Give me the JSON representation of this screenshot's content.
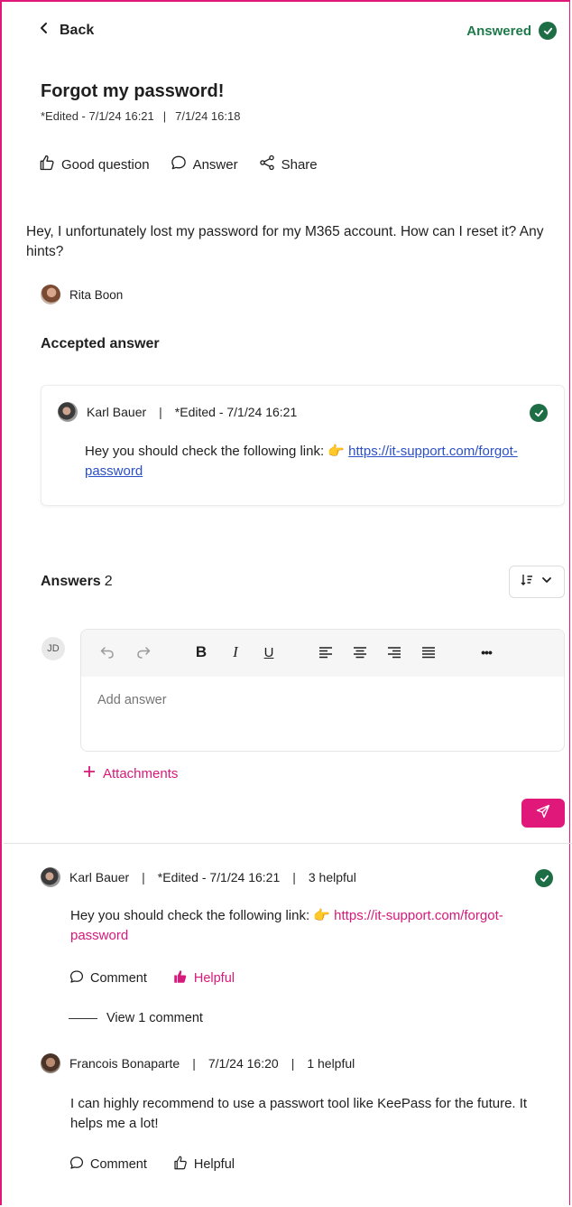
{
  "nav": {
    "back_label": "Back"
  },
  "status": {
    "label": "Answered",
    "color": "#1e6e45",
    "icon": "check-circle-icon"
  },
  "question": {
    "title": "Forgot my password!",
    "edited": "*Edited - 7/1/24 16:21",
    "created": "7/1/24 16:18",
    "body": "Hey, I unfortunately lost my password for my M365 account. How can I reset it? Any hints?",
    "author": "Rita Boon"
  },
  "actions": {
    "good_question": "Good question",
    "answer": "Answer",
    "share": "Share"
  },
  "accepted": {
    "heading": "Accepted answer",
    "author": "Karl Bauer",
    "edited": "*Edited - 7/1/24 16:21",
    "text": "Hey you should check the following link: ",
    "emoji": "👉",
    "link": "https://it-support.com/forgot-password"
  },
  "answers_section": {
    "heading": "Answers",
    "count": "2"
  },
  "editor": {
    "user_initials": "JD",
    "placeholder": "Add answer",
    "toolbar": {
      "undo": "undo-icon",
      "redo": "redo-icon",
      "bold": "B",
      "italic": "I",
      "underline": "U",
      "more": "•••"
    },
    "attachments_label": "Attachments"
  },
  "answers": [
    {
      "author": "Karl Bauer",
      "edited": "*Edited - 7/1/24 16:21",
      "helpful_count": "3 helpful",
      "text": "Hey you should check the following link: ",
      "emoji": "👉",
      "link": "https://it-support.com/forgot-password",
      "comment_label": "Comment",
      "helpful_label": "Helpful",
      "view_comments": "View 1 comment"
    },
    {
      "author": "Francois Bonaparte",
      "date": "7/1/24 16:20",
      "helpful_count": "1 helpful",
      "text": "I can highly recommend to use a passwort tool like KeePass for the future. It helps me a lot!",
      "comment_label": "Comment",
      "helpful_label": "Helpful"
    }
  ],
  "colors": {
    "accent": "#e0187a",
    "link_blue": "#2b4fc7",
    "success": "#1e6e45"
  }
}
